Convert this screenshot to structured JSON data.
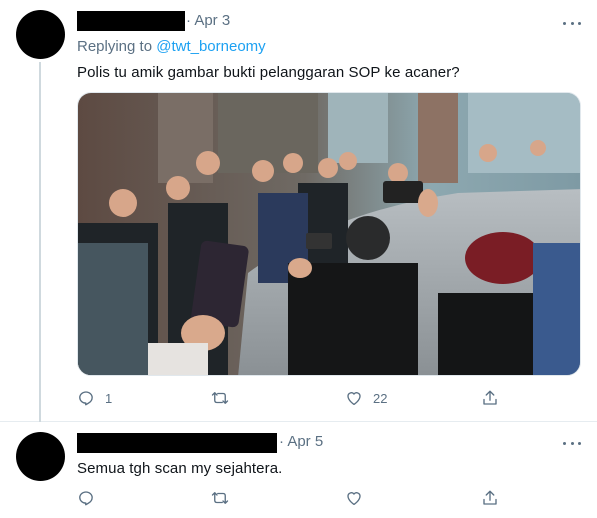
{
  "tweets": [
    {
      "date": "· Apr 3",
      "replying_prefix": "Replying to ",
      "replying_handle": "@twt_borneomy",
      "text": "Polis tu amik gambar bukti pelanggaran SOP ke acaner?",
      "reply_count": "1",
      "retweet_count": "",
      "like_count": "22"
    },
    {
      "date": "· Apr 5",
      "text": "Semua tgh scan my sejahtera.",
      "reply_count": "",
      "retweet_count": "",
      "like_count": ""
    }
  ],
  "icons": {
    "reply": "reply-icon",
    "retweet": "retweet-icon",
    "like": "heart-icon",
    "share": "share-icon",
    "more": "more-icon"
  },
  "colors": {
    "link": "#1da1f2",
    "muted": "#5b7083",
    "text": "#0f1419"
  }
}
